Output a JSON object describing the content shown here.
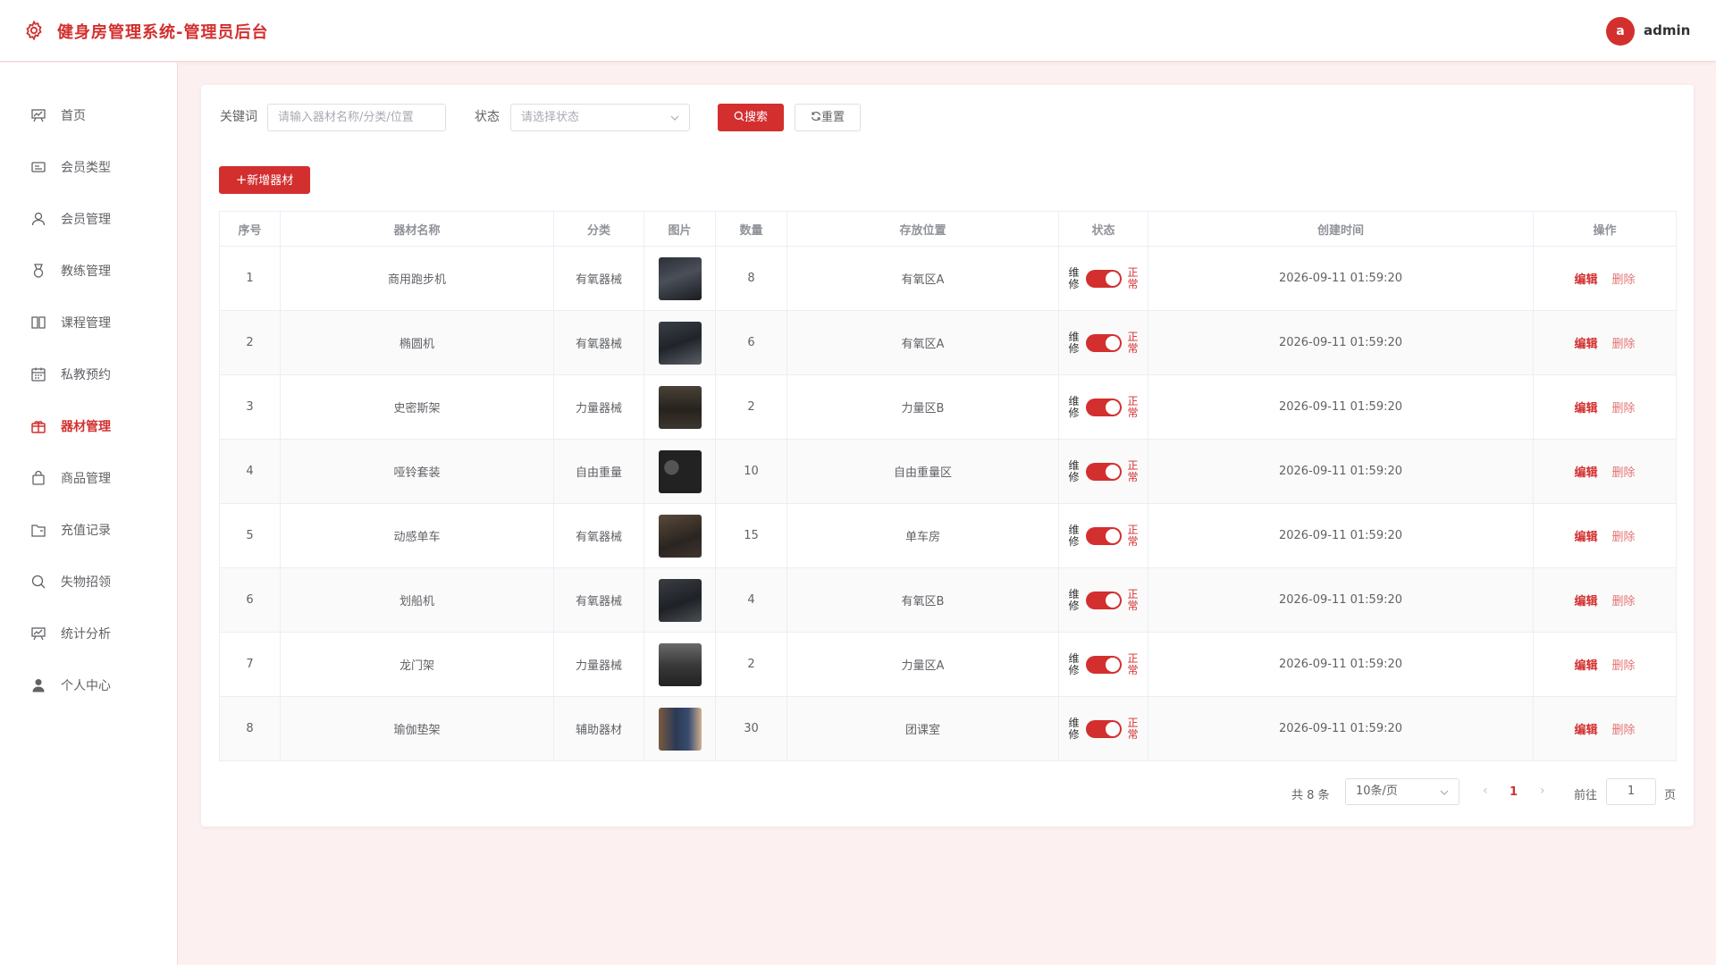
{
  "header": {
    "title": "健身房管理系统-管理员后台",
    "avatar_letter": "a",
    "username": "admin"
  },
  "colors": {
    "accent": "#d32f2f",
    "background": "#fdf0f0"
  },
  "sidebar": {
    "items": [
      {
        "label": "首页",
        "icon": "home-chart-icon"
      },
      {
        "label": "会员类型",
        "icon": "card-icon"
      },
      {
        "label": "会员管理",
        "icon": "user-icon"
      },
      {
        "label": "教练管理",
        "icon": "medal-icon"
      },
      {
        "label": "课程管理",
        "icon": "book-icon"
      },
      {
        "label": "私教预约",
        "icon": "calendar-icon"
      },
      {
        "label": "器材管理",
        "icon": "box-icon",
        "active": true
      },
      {
        "label": "商品管理",
        "icon": "bag-icon"
      },
      {
        "label": "充值记录",
        "icon": "folder-icon"
      },
      {
        "label": "失物招领",
        "icon": "search-icon"
      },
      {
        "label": "统计分析",
        "icon": "chart-icon"
      },
      {
        "label": "个人中心",
        "icon": "person-icon"
      }
    ]
  },
  "filters": {
    "keyword_label": "关键词",
    "keyword_placeholder": "请输入器材名称/分类/位置",
    "status_label": "状态",
    "status_placeholder": "请选择状态",
    "search_label": "搜索",
    "reset_label": "重置"
  },
  "add_label": "新增器材",
  "table": {
    "columns": [
      "序号",
      "器材名称",
      "分类",
      "图片",
      "数量",
      "存放位置",
      "状态",
      "创建时间",
      "操作"
    ],
    "switch_off_text": "维修",
    "switch_on_text": "正常",
    "edit_label": "编辑",
    "delete_label": "删除",
    "rows": [
      {
        "no": "1",
        "name": "商用跑步机",
        "category": "有氧器械",
        "qty": "8",
        "location": "有氧区A",
        "status_on": true,
        "created": "2026-09-11 01:59:20"
      },
      {
        "no": "2",
        "name": "椭圆机",
        "category": "有氧器械",
        "qty": "6",
        "location": "有氧区A",
        "status_on": true,
        "created": "2026-09-11 01:59:20"
      },
      {
        "no": "3",
        "name": "史密斯架",
        "category": "力量器械",
        "qty": "2",
        "location": "力量区B",
        "status_on": true,
        "created": "2026-09-11 01:59:20"
      },
      {
        "no": "4",
        "name": "哑铃套装",
        "category": "自由重量",
        "qty": "10",
        "location": "自由重量区",
        "status_on": true,
        "created": "2026-09-11 01:59:20"
      },
      {
        "no": "5",
        "name": "动感单车",
        "category": "有氧器械",
        "qty": "15",
        "location": "单车房",
        "status_on": true,
        "created": "2026-09-11 01:59:20"
      },
      {
        "no": "6",
        "name": "划船机",
        "category": "有氧器械",
        "qty": "4",
        "location": "有氧区B",
        "status_on": true,
        "created": "2026-09-11 01:59:20"
      },
      {
        "no": "7",
        "name": "龙门架",
        "category": "力量器械",
        "qty": "2",
        "location": "力量区A",
        "status_on": true,
        "created": "2026-09-11 01:59:20"
      },
      {
        "no": "8",
        "name": "瑜伽垫架",
        "category": "辅助器材",
        "qty": "30",
        "location": "团课室",
        "status_on": true,
        "created": "2026-09-11 01:59:20"
      }
    ]
  },
  "pager": {
    "total_text": "共 8 条",
    "page_size": "10条/页",
    "current_page": "1",
    "goto_label": "前往",
    "goto_value": "1",
    "page_suffix": "页"
  }
}
